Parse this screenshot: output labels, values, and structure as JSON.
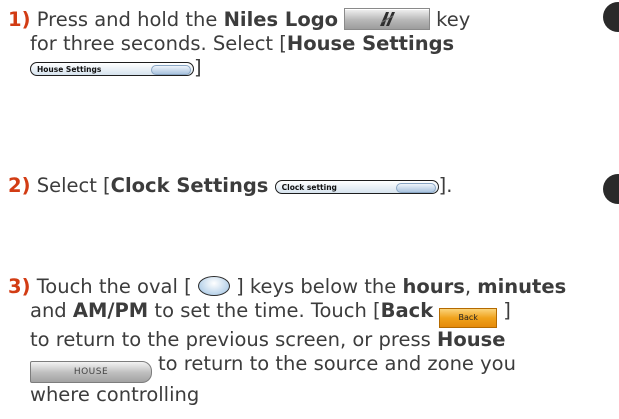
{
  "steps": [
    {
      "number": "1)",
      "line1_pre": "Press and hold the",
      "line1_bold": "Niles Logo",
      "line1_post": "key",
      "line2_pre": "for three seconds. Select [",
      "line2_bold": "House Settings",
      "button_label": "House Settings",
      "line3_post": "]"
    },
    {
      "number": "2)",
      "line1_pre": "Select [",
      "line1_bold": "Clock Settings",
      "button_label": "Clock setting",
      "line1_post": "]."
    },
    {
      "number": "3)",
      "l1_pre": "Touch the oval [",
      "l1_mid": "] keys below the",
      "l1_bold1": "hours",
      "l1_comma": ",",
      "l1_bold2": "minutes",
      "l2_pre": "and",
      "l2_bold1": "AM/PM",
      "l2_mid": "to set the time. Touch [",
      "l2_bold2": "Back",
      "back_label": "Back",
      "l2_post": "]",
      "l3_pre": "to return to the previous screen, or press",
      "l3_bold": "House",
      "house_label": "HOUSE",
      "l4_post": "to return to the source and zone you",
      "l5": "where controlling"
    }
  ],
  "colors": {
    "step_number": "#d23c14",
    "text": "#3c3c3c",
    "back_button": "#f0a21b"
  },
  "icons": [
    "niles-logo-icon",
    "oval-key-icon"
  ]
}
